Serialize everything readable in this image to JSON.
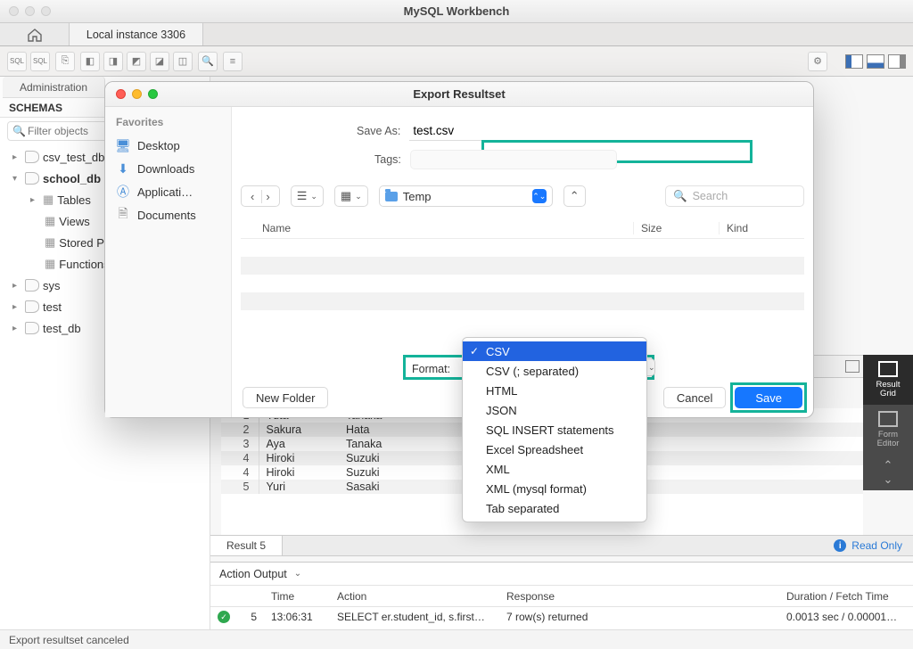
{
  "window": {
    "title": "MySQL Workbench"
  },
  "connection_tab": "Local instance 3306",
  "left": {
    "admin_tab": "Administration",
    "schemas": "SCHEMAS",
    "filter_placeholder": "Filter objects",
    "tree": {
      "item0": "csv_test_db",
      "item1": "school_db",
      "item1a": "Tables",
      "item1b": "Views",
      "item1c": "Stored Procedures",
      "item1d": "Functions",
      "item2": "sys",
      "item3": "test",
      "item4": "test_db"
    }
  },
  "dialog": {
    "title": "Export Resultset",
    "favorites_label": "Favorites",
    "fav": {
      "desktop": "Desktop",
      "downloads": "Downloads",
      "applications": "Applicati…",
      "documents": "Documents"
    },
    "save_as_label": "Save As:",
    "save_as_value": "test.csv",
    "tags_label": "Tags:",
    "folder": "Temp",
    "search_placeholder": "Search",
    "cols": {
      "name": "Name",
      "size": "Size",
      "kind": "Kind"
    },
    "format_label": "Format:",
    "new_folder": "New Folder",
    "cancel": "Cancel",
    "save": "Save",
    "formats": {
      "csv": "CSV",
      "csv_semi": "CSV (; separated)",
      "html": "HTML",
      "json": "JSON",
      "sql": "SQL INSERT statements",
      "excel": "Excel Spreadsheet",
      "xml": "XML",
      "xml_mysql": "XML (mysql format)",
      "tab": "Tab separated"
    }
  },
  "grid": {
    "rows": [
      {
        "n": "1",
        "first": "Yuta",
        "last": "Tanaka"
      },
      {
        "n": "2",
        "first": "Sakura",
        "last": "Hata"
      },
      {
        "n": "3",
        "first": "Aya",
        "last": "Tanaka"
      },
      {
        "n": "4",
        "first": "Hiroki",
        "last": "Suzuki"
      },
      {
        "n": "4",
        "first": "Hiroki",
        "last": "Suzuki"
      },
      {
        "n": "5",
        "first": "Yuri",
        "last": "Sasaki"
      }
    ]
  },
  "right_sidebar": {
    "result_grid": "Result\nGrid",
    "form_editor": "Form\nEditor"
  },
  "result_tab": "Result 5",
  "read_only": "Read Only",
  "action_output": {
    "label": "Action Output",
    "cols": {
      "time": "Time",
      "action": "Action",
      "response": "Response",
      "duration": "Duration / Fetch Time"
    },
    "row": {
      "idx": "5",
      "time": "13:06:31",
      "action": "SELECT  er.student_id,   s.first…",
      "response": "7 row(s) returned",
      "duration": "0.0013 sec / 0.00001…"
    }
  },
  "status": "Export resultset canceled"
}
